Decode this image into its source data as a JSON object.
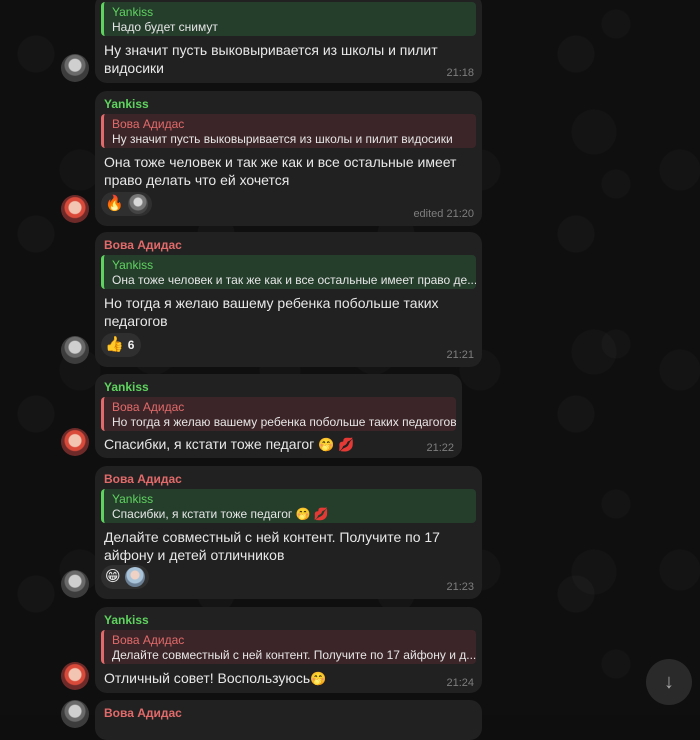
{
  "messages": [
    {
      "reply": {
        "name": "Yankiss",
        "text": "Надо будет снимут"
      },
      "text": "Ну значит пусть выковыривается из школы и пилит видосики",
      "time": "21:18"
    },
    {
      "sender": "Yankiss",
      "reply": {
        "name": "Вова Адидас",
        "text": "Ну значит пусть выковыривается из школы и пилит видосики"
      },
      "text": "Она тоже человек и так же как и все остальные имеет право делать что ей хочется",
      "reactions": [
        {
          "emoji": "🔥"
        }
      ],
      "time": "edited 21:20"
    },
    {
      "sender": "Вова Адидас",
      "reply": {
        "name": "Yankiss",
        "text": "Она тоже человек и так же как и все остальные имеет право де..."
      },
      "text": "Но тогда я желаю вашему ребенка побольше таких педагогов",
      "reactions": [
        {
          "emoji": "👍",
          "count": "6"
        }
      ],
      "time": "21:21"
    },
    {
      "sender": "Yankiss",
      "reply": {
        "name": "Вова Адидас",
        "text": "Но тогда я желаю вашему ребенка побольше таких педагогов"
      },
      "text": "Спасибки, я кстати тоже педагог",
      "text_emoji": "🤭 💋",
      "time": "21:22"
    },
    {
      "sender": "Вова Адидас",
      "reply": {
        "name": "Yankiss",
        "text": "Спасибки, я кстати тоже педагог",
        "emoji": "🤭 💋"
      },
      "text": "Делайте совместный с ней контент. Получите по 17 айфону и детей отличников",
      "reactions": [
        {
          "emoji": "😁"
        }
      ],
      "time": "21:23"
    },
    {
      "sender": "Yankiss",
      "reply": {
        "name": "Вова Адидас",
        "text": "Делайте совместный с ней контент. Получите по 17 айфону и д..."
      },
      "text": "Отличный совет! Воспользуюсь",
      "text_emoji": "🤭",
      "time": "21:24"
    },
    {
      "sender": "Вова Адидас"
    }
  ],
  "icons": {
    "scroll_down": "chevron-down-icon"
  },
  "colors": {
    "green_name": "#5fd35f",
    "red_name": "#e26a6a",
    "bubble": "#212121"
  }
}
